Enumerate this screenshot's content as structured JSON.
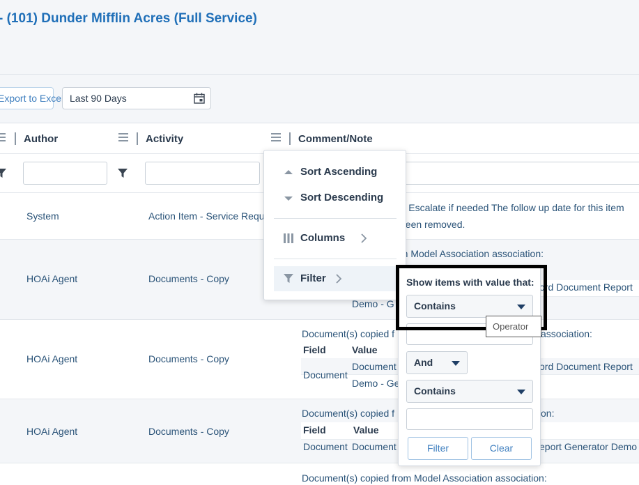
{
  "header": {
    "title": "- (101) Dunder Mifflin Acres (Full Service)"
  },
  "toolbar": {
    "export_label": "Export to Excel",
    "date_range": "Last 90 Days"
  },
  "columns": {
    "author": "Author",
    "activity": "Activity",
    "comment": "Comment/Note"
  },
  "rows": [
    {
      "author": "System",
      "activity": "Action Item - Service Request",
      "note_line1": "o - Escalate if needed The follow up date for this item",
      "note_line2": "been removed."
    },
    {
      "author": "HOAi Agent",
      "activity": "Documents - Copy",
      "note_line1": "om Model Association association:",
      "subtbl_value": "ord Document Report",
      "note_tail": "Demo - G"
    },
    {
      "author": "HOAi Agent",
      "activity": "Documents - Copy",
      "note_line1": "Document(s) copied f",
      "note_line1_tail": "association:",
      "field_hdr": "Field",
      "value_hdr": "Value",
      "field_val": "Document",
      "value_val": "Document",
      "value_tail": "ord Document Report",
      "note_tail": "Demo - Ge"
    },
    {
      "author": "HOAi Agent",
      "activity": "Documents - Copy",
      "note_line1": "Document(s) copied f",
      "note_line1_tail": "on:",
      "field_hdr": "Field",
      "value_hdr": "Value",
      "field_val": "Document",
      "value_val": "Document",
      "value_tail": "eport Generator Demo"
    },
    {
      "note_line1": "Document(s) copied from Model Association association:"
    }
  ],
  "column_menu": {
    "sort_asc": "Sort Ascending",
    "sort_desc": "Sort Descending",
    "columns": "Columns",
    "filter": "Filter"
  },
  "filter_popup": {
    "label": "Show items with value that:",
    "operator1": "Contains",
    "logic": "And",
    "operator2": "Contains",
    "filter_btn": "Filter",
    "clear_btn": "Clear"
  },
  "tooltip": {
    "text": "Operator"
  }
}
